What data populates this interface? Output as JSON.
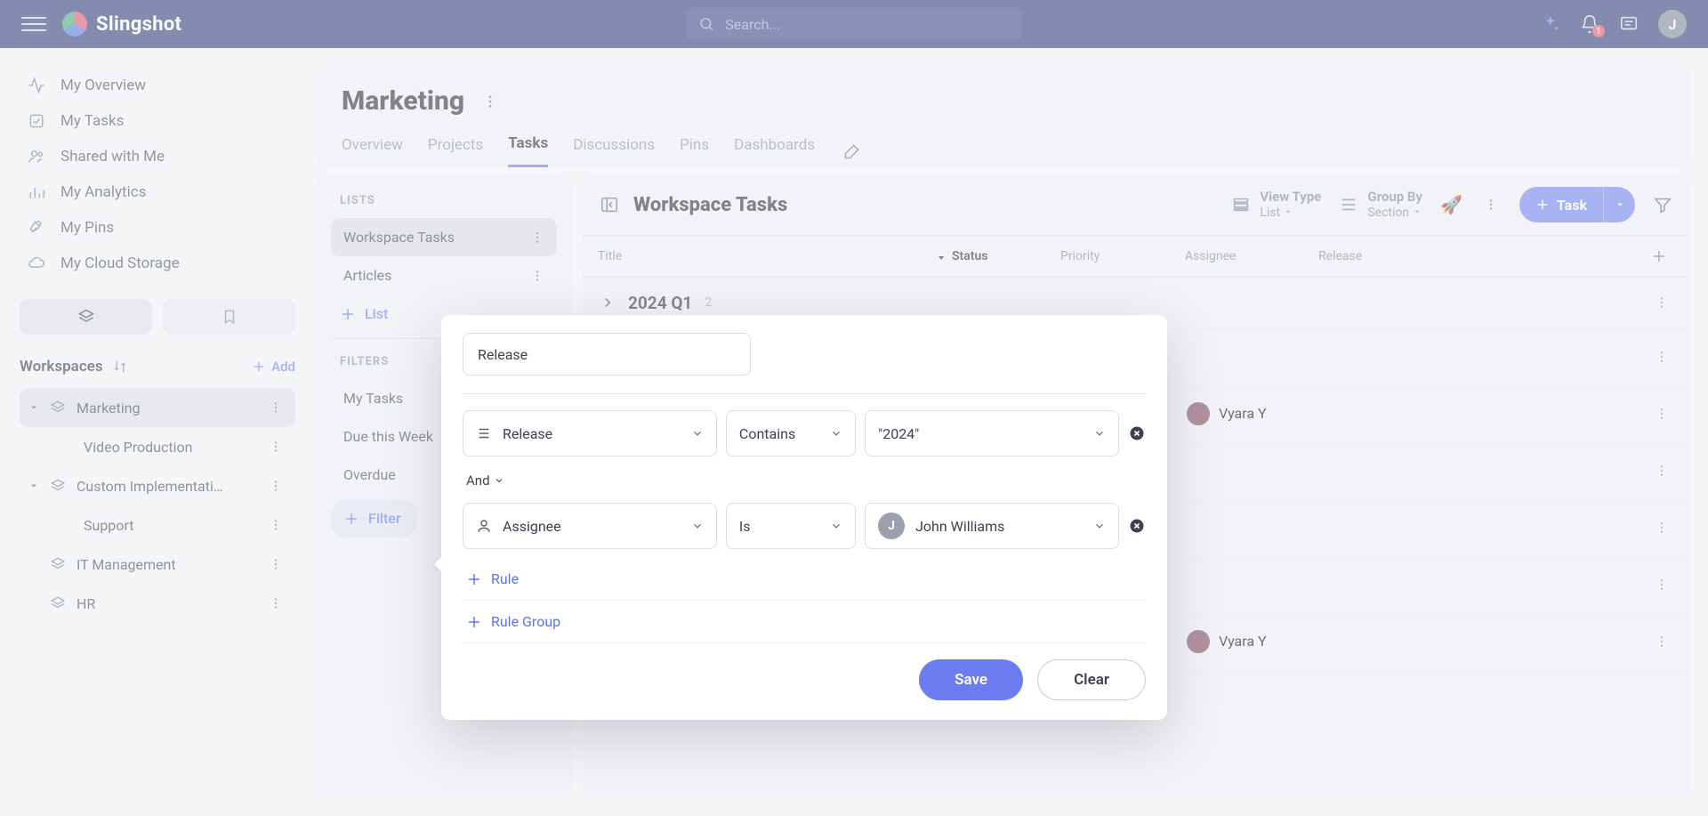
{
  "brand": "Slingshot",
  "search": {
    "placeholder": "Search..."
  },
  "notifications_badge": "1",
  "avatar_initial_top": "J",
  "nav": [
    {
      "label": "My Overview"
    },
    {
      "label": "My Tasks"
    },
    {
      "label": "Shared with Me"
    },
    {
      "label": "My Analytics"
    },
    {
      "label": "My Pins"
    },
    {
      "label": "My Cloud Storage"
    }
  ],
  "workspaces_heading": "Workspaces",
  "add_label": "Add",
  "workspaces": [
    {
      "label": "Marketing",
      "expanded": true,
      "active": true,
      "children": [
        {
          "label": "Video Production"
        }
      ]
    },
    {
      "label": "Custom Implementati…",
      "expanded": true,
      "children": [
        {
          "label": "Support"
        }
      ]
    },
    {
      "label": "IT Management"
    },
    {
      "label": "HR"
    }
  ],
  "page_title": "Marketing",
  "tabs": [
    "Overview",
    "Projects",
    "Tasks",
    "Discussions",
    "Pins",
    "Dashboards"
  ],
  "active_tab": "Tasks",
  "lists_heading": "LISTS",
  "lists": [
    "Workspace Tasks",
    "Articles"
  ],
  "active_list": "Workspace Tasks",
  "list_add": "List",
  "filters_heading": "FILTERS",
  "filters": [
    "My Tasks",
    "Due this Week",
    "Overdue"
  ],
  "filter_add": "Filter",
  "table": {
    "title": "Workspace Tasks",
    "view_type": {
      "label": "View Type",
      "value": "List"
    },
    "group_by": {
      "label": "Group By",
      "value": "Section"
    },
    "task_btn": "Task",
    "columns": {
      "title": "Title",
      "status": "Status",
      "priority": "Priority",
      "assignee": "Assignee",
      "release": "Release"
    },
    "group": {
      "name": "2024 Q1",
      "count": "2"
    },
    "rows": [
      {
        "assignee": ""
      },
      {
        "assignee": "Vyara Y"
      },
      {
        "assignee": ""
      },
      {
        "assignee": ""
      },
      {
        "assignee": ""
      },
      {
        "assignee": "Vyara Y"
      }
    ]
  },
  "popover": {
    "name_value": "Release",
    "rule1": {
      "field": "Release",
      "op": "Contains",
      "value": "\"2024\""
    },
    "conjunction": "And",
    "rule2": {
      "field": "Assignee",
      "op": "Is",
      "value": "John Williams",
      "avatar": "J"
    },
    "add_rule": "Rule",
    "add_group": "Rule Group",
    "save": "Save",
    "clear": "Clear"
  }
}
